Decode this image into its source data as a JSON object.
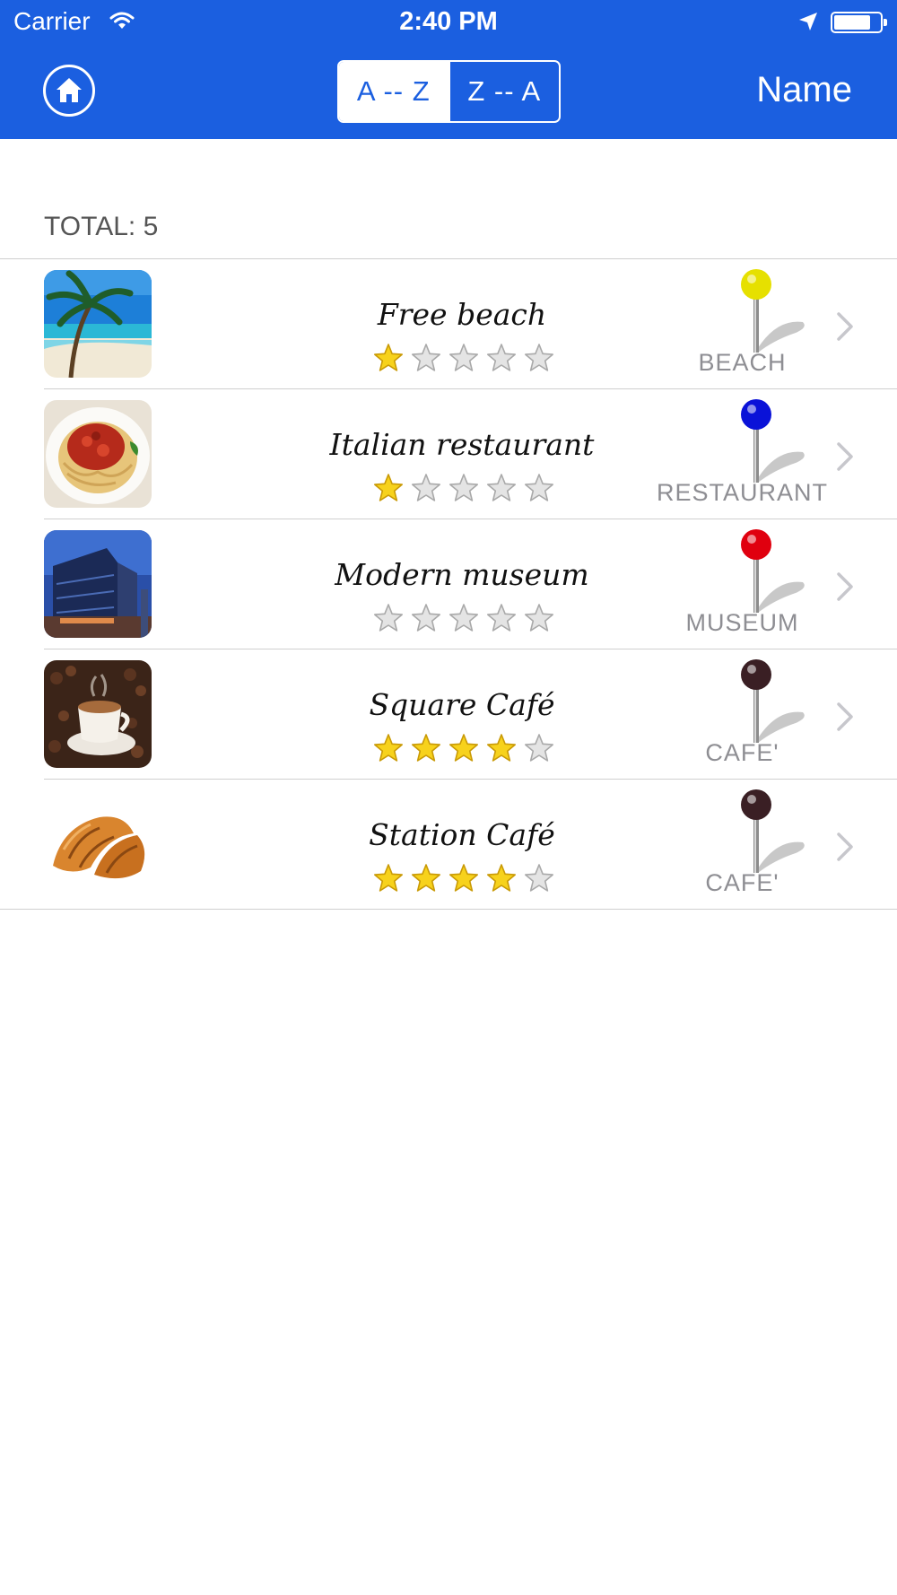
{
  "status_bar": {
    "carrier": "Carrier",
    "time": "2:40 PM"
  },
  "nav": {
    "home_icon": "home-icon",
    "sort_options": [
      {
        "label": "A -- Z",
        "selected": true
      },
      {
        "label": "Z -- A",
        "selected": false
      }
    ],
    "sort_field": "Name",
    "accent_color": "#1b5fe0"
  },
  "total_label": "TOTAL: 5",
  "items": [
    {
      "name": "Free beach",
      "rating": 1,
      "category": "BEACH",
      "pin_color": "#e6e000",
      "thumbnail": "beach-photo"
    },
    {
      "name": "Italian restaurant",
      "rating": 1,
      "category": "RESTAURANT",
      "pin_color": "#0a12d8",
      "thumbnail": "spaghetti-photo"
    },
    {
      "name": "Modern museum",
      "rating": 0,
      "category": "MUSEUM",
      "pin_color": "#e0000f",
      "thumbnail": "museum-building-photo"
    },
    {
      "name": "Square Café",
      "rating": 4,
      "category": "CAFE'",
      "pin_color": "#3a1f24",
      "thumbnail": "coffee-cup-photo"
    },
    {
      "name": "Station Café",
      "rating": 4,
      "category": "CAFE'",
      "pin_color": "#3a1f24",
      "thumbnail": "croissant-photo"
    }
  ]
}
